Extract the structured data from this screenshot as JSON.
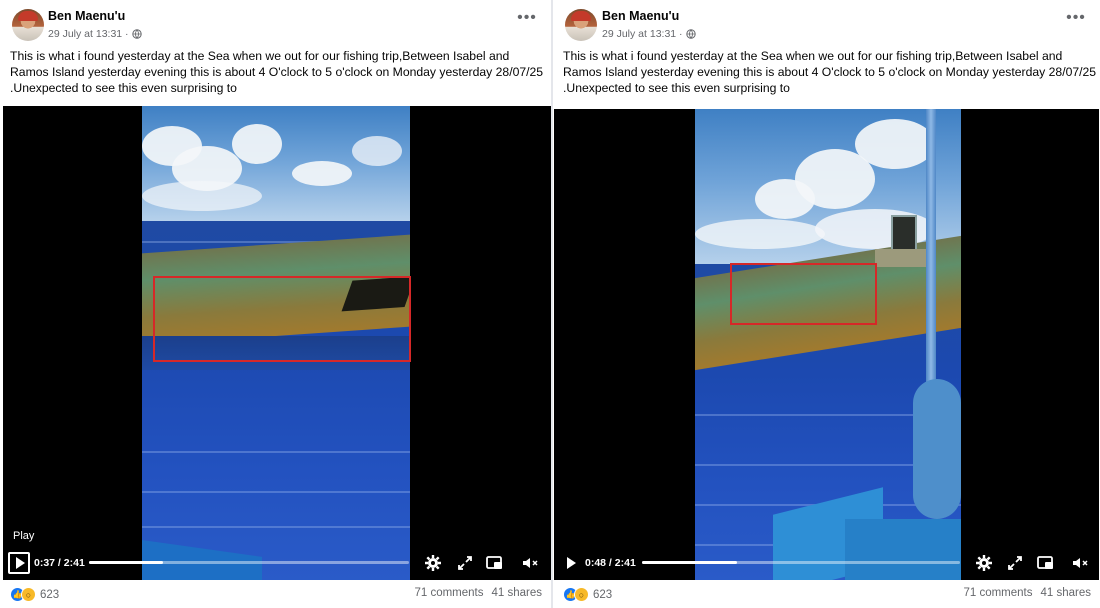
{
  "posts": [
    {
      "author": "Ben Maenu'u",
      "timestamp": "29 July at 13:31 ·",
      "caption": "This is what i found yesterday at the Sea when we out for our fishing trip,Between Isabel and Ramos Island yesterday evening this is about 4 O'clock to 5 o'clock on Monday yesterday 28/07/25 .Unexpected to see this even surprising to",
      "more_icon": "more-options-icon",
      "video": {
        "play_label": "Play",
        "time": "0:37 / 2:41",
        "progress": 0.23
      },
      "reactions_count": "623",
      "comments": "71 comments",
      "shares": "41 shares"
    },
    {
      "author": "Ben Maenu'u",
      "timestamp": "29 July at 13:31 ·",
      "caption": "This is what i found yesterday at the Sea when we out for our fishing trip,Between Isabel and Ramos Island yesterday evening this is about 4 O'clock to 5 o'clock on Monday yesterday 28/07/25 .Unexpected to see this even surprising to",
      "more_icon": "more-options-icon",
      "video": {
        "play_label": "",
        "time": "0:48 / 2:41",
        "progress": 0.3
      },
      "reactions_count": "623",
      "comments": "71 comments",
      "shares": "41 shares"
    }
  ],
  "colors": {
    "highlight_box": "#d62828",
    "like_blue": "#1877f2",
    "wow_yellow": "#f7b928"
  }
}
